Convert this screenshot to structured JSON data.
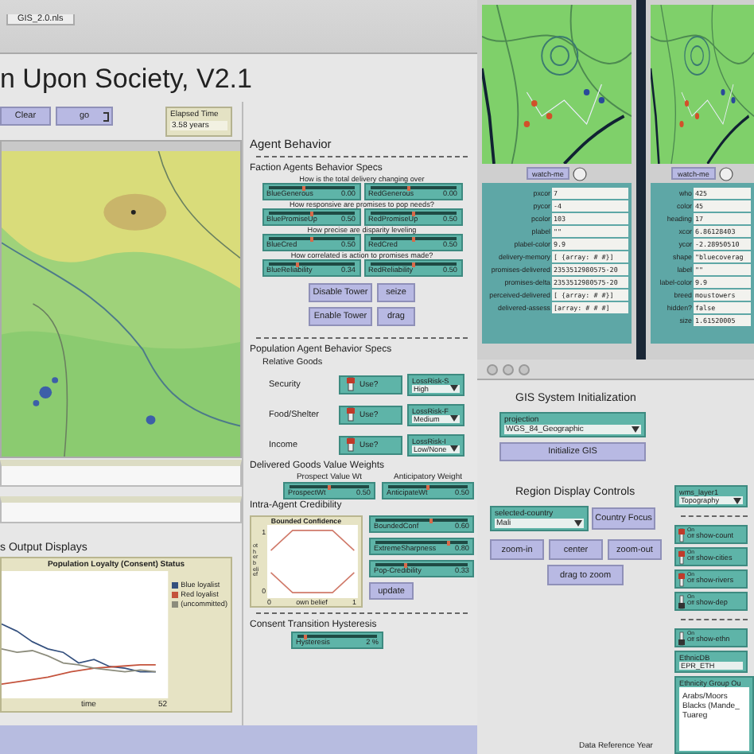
{
  "tab": "GIS_2.0.nls",
  "title": "n Upon Society, V2.1",
  "run_buttons": [
    {
      "label": "Clear",
      "kind": "once"
    },
    {
      "label": "go",
      "kind": "forever"
    }
  ],
  "elapsed": {
    "label": "Elapsed Time",
    "value": "3.58 years"
  },
  "output_heading": "s Output Displays",
  "loyalty_plot": {
    "title": "Population Loyalty (Consent) Status",
    "xlabel": "time",
    "xmax": "52",
    "legend": [
      {
        "name": "Blue loyalist",
        "color": "#34507e"
      },
      {
        "name": "Red loyalist",
        "color": "#c4533c"
      },
      {
        "name": "(uncommitted)",
        "color": "#8c8c7c"
      }
    ]
  },
  "agent_behavior": {
    "heading": "Agent Behavior",
    "faction_heading": "Faction Agents Behavior Specs",
    "slider_groups": [
      {
        "question": "How is the total delivery changing over",
        "sliders": [
          {
            "name": "BlueGenerous",
            "value": "0.00",
            "level": 0.42
          },
          {
            "name": "RedGenerous",
            "value": "0.00",
            "level": 0.45
          }
        ]
      },
      {
        "question": "How responsive are promises to pop needs?",
        "sliders": [
          {
            "name": "BluePromiseUp",
            "value": "0.50",
            "level": 0.5
          },
          {
            "name": "RedPromiseUp",
            "value": "0.50",
            "level": 0.5
          }
        ]
      },
      {
        "question": "How precise are disparity leveling",
        "sliders": [
          {
            "name": "BlueCred",
            "value": "0.50",
            "level": 0.5
          },
          {
            "name": "RedCred",
            "value": "0.50",
            "level": 0.5
          }
        ]
      },
      {
        "question": "How correlated is action to promises made?",
        "sliders": [
          {
            "name": "BlueReliability",
            "value": "0.34",
            "level": 0.34
          },
          {
            "name": "RedReliability",
            "value": "0.50",
            "level": 0.5
          }
        ]
      }
    ],
    "tower_buttons": [
      "Disable Tower",
      "seize",
      "Enable Tower",
      "drag"
    ],
    "population_heading": "Population Agent Behavior Specs",
    "goods_heading": "Relative Goods",
    "goods": [
      {
        "label": "Security",
        "switch": {
          "label": "Use?",
          "on": true
        },
        "chooser": {
          "name": "LossRisk-S",
          "value": "High"
        }
      },
      {
        "label": "Food/Shelter",
        "switch": {
          "label": "Use?",
          "on": true
        },
        "chooser": {
          "name": "LossRisk-F",
          "value": "Medium"
        }
      },
      {
        "label": "Income",
        "switch": {
          "label": "Use?",
          "on": true
        },
        "chooser": {
          "name": "LossRisk-I",
          "value": "Low/None"
        }
      }
    ],
    "weights_heading": "Delivered Goods Value Weights",
    "weights": [
      {
        "caption": "Prospect Value Wt",
        "slider": {
          "name": "ProspectWt",
          "value": "0.50",
          "level": 0.5
        }
      },
      {
        "caption": "Anticipatory Weight",
        "slider": {
          "name": "AnticipateWt",
          "value": "0.50",
          "level": 0.5
        }
      }
    ],
    "credibility_heading": "Intra-Agent Credibility",
    "confidence_plot": {
      "title": "Bounded Confidence",
      "ylabel": "other belief",
      "xlabel": "own belief",
      "ymax": "1",
      "ymin": "0",
      "xmin": "0",
      "xmax": "1"
    },
    "credibility_sliders": [
      {
        "name": "BoundedConf",
        "value": "0.60",
        "level": 0.6
      },
      {
        "name": "ExtremeSharpness",
        "value": "0.80",
        "level": 0.8
      },
      {
        "name": "Pop-Credibility",
        "value": "0.33",
        "level": 0.33
      }
    ],
    "update_button": "update",
    "hysteresis_heading": "Consent Transition Hysteresis",
    "hysteresis": {
      "name": "Hysteresis",
      "value": "2 %",
      "level": 0.1
    }
  },
  "agent_monitors": [
    {
      "watch_button": "watch-me",
      "fields": [
        {
          "label": "pxcor",
          "value": "7"
        },
        {
          "label": "pycor",
          "value": "-4"
        },
        {
          "label": "pcolor",
          "value": "103"
        },
        {
          "label": "plabel",
          "value": "\"\""
        },
        {
          "label": "plabel-color",
          "value": "9.9"
        },
        {
          "label": "delivery-memory",
          "value": "[ {array: # #}]"
        },
        {
          "label": "promises-delivered",
          "value": "2353512980575-20"
        },
        {
          "label": "promises-delta",
          "value": "2353512980575-20"
        },
        {
          "label": "perceived-delivered",
          "value": "[ {array: # #}]"
        },
        {
          "label": "delivered-assess",
          "value": "[array: # # #]"
        }
      ]
    },
    {
      "watch_button": "watch-me",
      "fields": [
        {
          "label": "who",
          "value": "425"
        },
        {
          "label": "color",
          "value": "45"
        },
        {
          "label": "heading",
          "value": "17"
        },
        {
          "label": "xcor",
          "value": "6.86128403"
        },
        {
          "label": "ycor",
          "value": "-2.28950510"
        },
        {
          "label": "shape",
          "value": "\"bluecoverag"
        },
        {
          "label": "label",
          "value": "\"\""
        },
        {
          "label": "label-color",
          "value": "9.9"
        },
        {
          "label": "breed",
          "value": "moustowers"
        },
        {
          "label": "hidden?",
          "value": "false"
        },
        {
          "label": "size",
          "value": "1.61520005"
        }
      ]
    }
  ],
  "gis": {
    "init_heading": "GIS System Initialization",
    "projection": {
      "name": "projection",
      "value": "WGS_84_Geographic"
    },
    "init_button": "Initialize GIS",
    "region_heading": "Region Display Controls",
    "country": {
      "name": "selected-country",
      "value": "Mali"
    },
    "focus_button": "Country Focus",
    "zoom_buttons": [
      "zoom-in",
      "center",
      "zoom-out"
    ],
    "drag_button": "drag to zoom",
    "year_label": "Data Reference Year",
    "layer": {
      "name": "wms_layer1",
      "value": "Topography"
    },
    "layer_switches": [
      {
        "label": "show-count",
        "on": true,
        "marks": [
          "On",
          "Off"
        ]
      },
      {
        "label": "show-cities",
        "on": true,
        "marks": [
          "On",
          "Off"
        ]
      },
      {
        "label": "show-rivers",
        "on": true,
        "marks": [
          "On",
          "Off"
        ]
      },
      {
        "label": "show-dep",
        "on": false,
        "marks": [
          "On",
          "Off"
        ]
      }
    ],
    "ethnic_switch": {
      "label": "show-ethn",
      "on": false,
      "marks": [
        "On",
        "Off"
      ]
    },
    "ethnic_db": {
      "name": "EthnicDB",
      "value": "EPR_ETH"
    },
    "ethnic_list": {
      "title": "Ethnicity Group Ou",
      "items": [
        "Arabs/Moors",
        "Blacks (Mande_",
        "Tuareg"
      ]
    }
  }
}
